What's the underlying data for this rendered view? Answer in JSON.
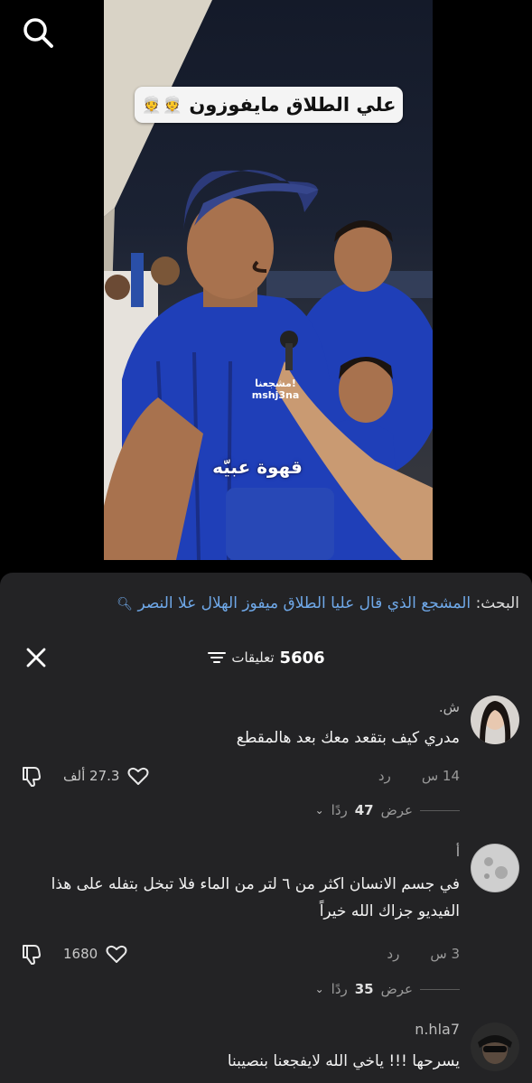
{
  "video": {
    "caption": "علي الطلاق مايفوزون",
    "caption_emoji": "👳👳",
    "mic_label": "مشجعنا!\nmshj3na",
    "watermark": "قهوة عبيّه"
  },
  "sheet": {
    "search_prefix": "البحث:",
    "search_query": "المشجع الذي قال عليا الطلاق ميفوز الهلال علا النصر",
    "comment_count": "5606",
    "comment_count_label": "تعليقات"
  },
  "comments": [
    {
      "username": "ش.",
      "text": "مدري كيف بتقعد معك بعد هالمقطع",
      "time": "14 س",
      "reply_label": "رد",
      "likes": "27.3 ألف",
      "view_replies_prefix": "عرض",
      "view_replies_count": "47",
      "view_replies_suffix": "ردًا"
    },
    {
      "username": "أ",
      "text": "في جسم الانسان اكثر من ٦ لتر من الماء فلا تبخل بتفله على هذا الفيديو جزاك الله خيراً",
      "time": "3 س",
      "reply_label": "رد",
      "likes": "1680",
      "view_replies_prefix": "عرض",
      "view_replies_count": "35",
      "view_replies_suffix": "ردًا"
    },
    {
      "username": "n.hla7",
      "text": "يسرحها !!! ياخي الله لايفجعنا بنصيبنا"
    }
  ],
  "colors": {
    "sheet_bg": "#232325",
    "link_blue": "#6fa8e8",
    "jersey_blue": "#1f3fb8"
  },
  "icons": [
    "search-icon",
    "close-icon",
    "filter-icon",
    "heart-icon",
    "dislike-icon",
    "chevron-down-icon"
  ]
}
